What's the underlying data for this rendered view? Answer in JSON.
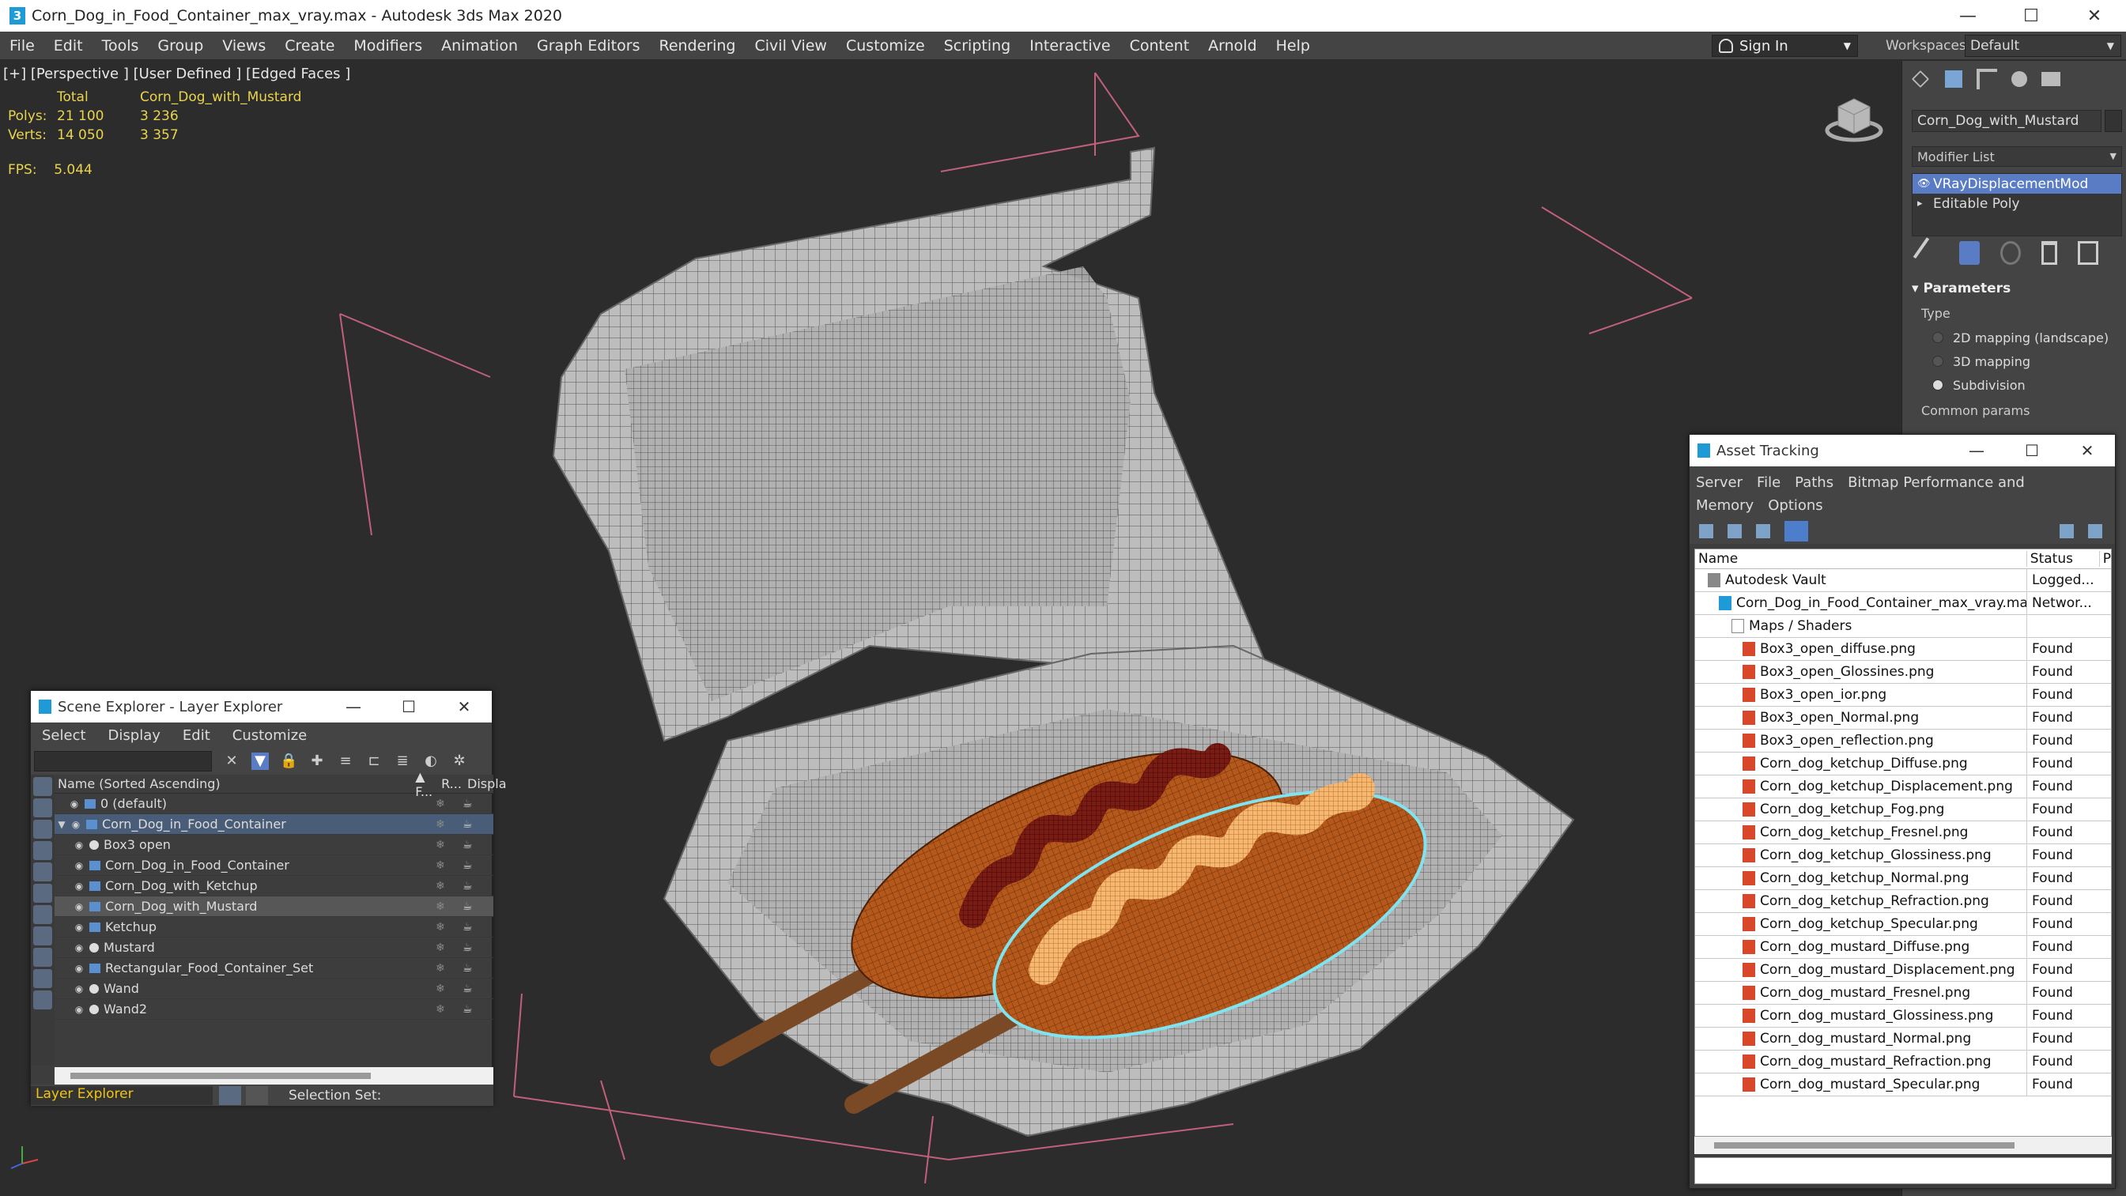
{
  "window": {
    "title": "Corn_Dog_in_Food_Container_max_vray.max - Autodesk 3ds Max 2020",
    "app_icon": "3",
    "minimize": "—",
    "maximize": "☐",
    "close": "✕"
  },
  "menu": [
    "File",
    "Edit",
    "Tools",
    "Group",
    "Views",
    "Create",
    "Modifiers",
    "Animation",
    "Graph Editors",
    "Rendering",
    "Civil View",
    "Customize",
    "Scripting",
    "Interactive",
    "Content",
    "Arnold",
    "Help"
  ],
  "signin": {
    "label": "Sign In",
    "caret": "▼"
  },
  "workspace": {
    "label": "Workspaces:",
    "value": "Default",
    "caret": "▼"
  },
  "viewport": {
    "label": "[+] [Perspective ] [User Defined ] [Edged Faces ]",
    "stats": {
      "header_total": "Total",
      "header_object": "Corn_Dog_with_Mustard",
      "polys_label": "Polys:",
      "polys_total": "21 100",
      "polys_object": "3 236",
      "verts_label": "Verts:",
      "verts_total": "14 050",
      "verts_object": "3 357"
    },
    "fps_label": "FPS:",
    "fps_value": "5.044"
  },
  "command_panel": {
    "object_name": "Corn_Dog_with_Mustard",
    "modifier_list": "Modifier List",
    "modifier_caret": "▼",
    "modifiers": [
      {
        "name": "VRayDisplacementMod",
        "selected": true,
        "prefix": "👁"
      },
      {
        "name": "Editable Poly",
        "selected": false,
        "prefix": "▸"
      }
    ],
    "parameters_header": "Parameters",
    "type_label": "Type",
    "options": [
      {
        "label": "2D mapping (landscape)",
        "on": false
      },
      {
        "label": "3D mapping",
        "on": false
      },
      {
        "label": "Subdivision",
        "on": true
      }
    ],
    "common_params": "Common params"
  },
  "scene_explorer": {
    "title": "Scene Explorer - Layer Explorer",
    "menu": [
      "Select",
      "Display",
      "Edit",
      "Customize"
    ],
    "columns": {
      "name": "Name (Sorted Ascending)",
      "frozen": "▲ F...",
      "render": "R...",
      "display": "Displa"
    },
    "rows": [
      {
        "label": "0 (default)",
        "indent": 40,
        "kind": "layer0",
        "style": ""
      },
      {
        "label": "Corn_Dog_in_Food_Container",
        "indent": 18,
        "kind": "layer",
        "style": "highlight"
      },
      {
        "label": "Box3 open",
        "indent": 46,
        "kind": "obj",
        "style": ""
      },
      {
        "label": "Corn_Dog_in_Food_Container",
        "indent": 46,
        "kind": "grp",
        "style": ""
      },
      {
        "label": "Corn_Dog_with_Ketchup",
        "indent": 46,
        "kind": "grp",
        "style": ""
      },
      {
        "label": "Corn_Dog_with_Mustard",
        "indent": 46,
        "kind": "grp",
        "style": "selected"
      },
      {
        "label": "Ketchup",
        "indent": 46,
        "kind": "grp",
        "style": ""
      },
      {
        "label": "Mustard",
        "indent": 46,
        "kind": "obj",
        "style": ""
      },
      {
        "label": "Rectangular_Food_Container_Set",
        "indent": 46,
        "kind": "grp",
        "style": ""
      },
      {
        "label": "Wand",
        "indent": 46,
        "kind": "obj",
        "style": ""
      },
      {
        "label": "Wand2",
        "indent": 46,
        "kind": "obj",
        "style": ""
      }
    ],
    "footer_mode": "Layer Explorer",
    "footer_selset": "Selection Set:"
  },
  "asset_tracking": {
    "title": "Asset Tracking",
    "menu": [
      "Server",
      "File",
      "Paths",
      "Bitmap Performance and Memory",
      "Options"
    ],
    "col_name": "Name",
    "col_status": "Status",
    "col_extra": "P",
    "rows": [
      {
        "name": "Autodesk Vault",
        "status": "Logged...",
        "indent": 16,
        "icon": "vault"
      },
      {
        "name": "Corn_Dog_in_Food_Container_max_vray.max",
        "status": "Networ...",
        "indent": 30,
        "icon": "max"
      },
      {
        "name": "Maps / Shaders",
        "status": "",
        "indent": 46,
        "icon": "folder"
      },
      {
        "name": "Box3_open_diffuse.png",
        "status": "Found",
        "indent": 60,
        "icon": "bitmap"
      },
      {
        "name": "Box3_open_Glossines.png",
        "status": "Found",
        "indent": 60,
        "icon": "bitmap"
      },
      {
        "name": "Box3_open_ior.png",
        "status": "Found",
        "indent": 60,
        "icon": "bitmap"
      },
      {
        "name": "Box3_open_Normal.png",
        "status": "Found",
        "indent": 60,
        "icon": "bitmap"
      },
      {
        "name": "Box3_open_reflection.png",
        "status": "Found",
        "indent": 60,
        "icon": "bitmap"
      },
      {
        "name": "Corn_dog_ketchup_Diffuse.png",
        "status": "Found",
        "indent": 60,
        "icon": "bitmap"
      },
      {
        "name": "Corn_dog_ketchup_Displacement.png",
        "status": "Found",
        "indent": 60,
        "icon": "bitmap"
      },
      {
        "name": "Corn_dog_ketchup_Fog.png",
        "status": "Found",
        "indent": 60,
        "icon": "bitmap"
      },
      {
        "name": "Corn_dog_ketchup_Fresnel.png",
        "status": "Found",
        "indent": 60,
        "icon": "bitmap"
      },
      {
        "name": "Corn_dog_ketchup_Glossiness.png",
        "status": "Found",
        "indent": 60,
        "icon": "bitmap"
      },
      {
        "name": "Corn_dog_ketchup_Normal.png",
        "status": "Found",
        "indent": 60,
        "icon": "bitmap"
      },
      {
        "name": "Corn_dog_ketchup_Refraction.png",
        "status": "Found",
        "indent": 60,
        "icon": "bitmap"
      },
      {
        "name": "Corn_dog_ketchup_Specular.png",
        "status": "Found",
        "indent": 60,
        "icon": "bitmap"
      },
      {
        "name": "Corn_dog_mustard_Diffuse.png",
        "status": "Found",
        "indent": 60,
        "icon": "bitmap"
      },
      {
        "name": "Corn_dog_mustard_Displacement.png",
        "status": "Found",
        "indent": 60,
        "icon": "bitmap"
      },
      {
        "name": "Corn_dog_mustard_Fresnel.png",
        "status": "Found",
        "indent": 60,
        "icon": "bitmap"
      },
      {
        "name": "Corn_dog_mustard_Glossiness.png",
        "status": "Found",
        "indent": 60,
        "icon": "bitmap"
      },
      {
        "name": "Corn_dog_mustard_Normal.png",
        "status": "Found",
        "indent": 60,
        "icon": "bitmap"
      },
      {
        "name": "Corn_dog_mustard_Refraction.png",
        "status": "Found",
        "indent": 60,
        "icon": "bitmap"
      },
      {
        "name": "Corn_dog_mustard_Specular.png",
        "status": "Found",
        "indent": 60,
        "icon": "bitmap"
      }
    ]
  },
  "colors": {
    "stats_text": "#e8d44d",
    "selected_modifier": "#5a7cc4",
    "layer_mode_text": "#f1c40f",
    "selection_outline": "#7fe3f0"
  }
}
